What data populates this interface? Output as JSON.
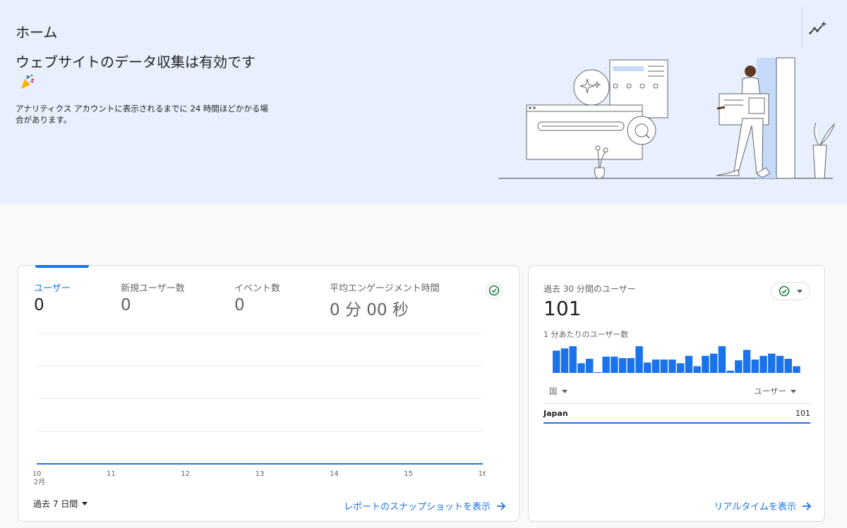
{
  "header": {
    "title": "ホーム"
  },
  "hero": {
    "headline": "ウェブサイトのデータ収集は有効です",
    "subtext": "アナリティクス アカウントに表示されるまでに 24 時間ほどかかる場合があります。"
  },
  "overview": {
    "metrics": [
      {
        "label": "ユーザー",
        "value": "0"
      },
      {
        "label": "新規ユーザー数",
        "value": "0"
      },
      {
        "label": "イベント数",
        "value": "0"
      },
      {
        "label": "平均エンゲージメント時間",
        "value": "0 分 00 秒"
      }
    ],
    "period_label": "過去 7 日間",
    "snapshot_link": "レポートのスナップショットを表示",
    "status_color": "#188038"
  },
  "chart_data": [
    {
      "type": "line",
      "x": [
        "10",
        "11",
        "12",
        "13",
        "14",
        "15",
        "16"
      ],
      "x_month_label": "2月",
      "series": [
        {
          "values": [
            0,
            0,
            0,
            0,
            0,
            0,
            0
          ]
        }
      ],
      "grid": true,
      "color": "#1a73e8"
    },
    {
      "type": "bar",
      "title": "1 分あたりのユーザー数",
      "values": [
        3,
        3.3,
        3.6,
        1.3,
        1.9,
        0.1,
        2.2,
        2.2,
        2,
        2,
        3.6,
        1.4,
        1.8,
        1.8,
        1.8,
        1.3,
        2.3,
        0.9,
        2.3,
        2.6,
        3.6,
        0.3,
        1.7,
        3.1,
        1.8,
        2.3,
        2.6,
        2.3,
        1.9,
        0.9
      ],
      "color": "#1a73e8"
    }
  ],
  "realtime": {
    "label": "過去 30 分間のユーザー",
    "value": "101",
    "per_minute_label": "1 分あたりのユーザー数",
    "col_country": "国",
    "col_users": "ユーザー",
    "rows": [
      {
        "country": "Japan",
        "users": "101"
      }
    ],
    "link": "リアルタイムを表示"
  },
  "icons": {
    "insights": "insights-sparkle-icon",
    "party": "party-popper-icon",
    "status": "check-circle-icon",
    "arrow": "arrow-right-icon"
  }
}
